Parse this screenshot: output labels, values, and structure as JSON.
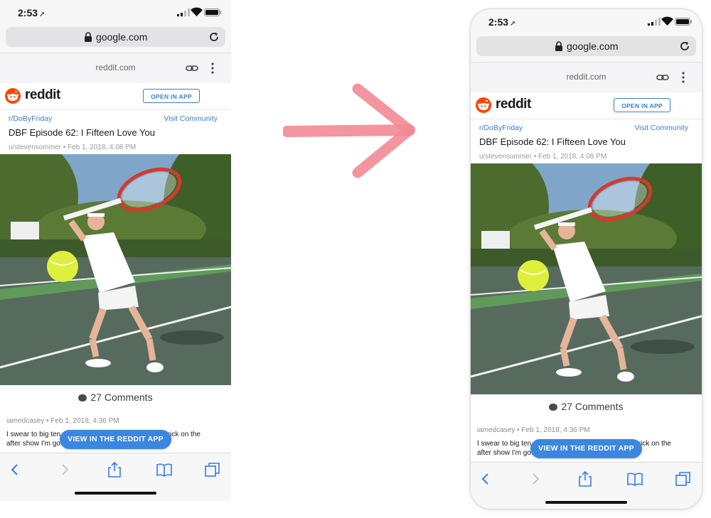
{
  "status_time": "2:53",
  "url_domain": "google.com",
  "page_site": "reddit.com",
  "reddit_wordmark": "reddit",
  "open_in_app": "OPEN IN APP",
  "subreddit": "r/DoByFriday",
  "visit_community": "Visit Community",
  "post_title": "DBF Episode 62: I Fifteen Love You",
  "post_meta": "u/stevensommer • Feb 1, 2018, 4:08 PM",
  "comments_count": "27 Comments",
  "comment_meta": "iamedcasey • Feb 1, 2018, 4:36 PM",
  "comment_text_a": "I swear to big ten",
  "comment_text_b": "d his trick on the",
  "comment_text_c": "after show I'm go",
  "view_in_app": "VIEW IN THE REDDIT APP",
  "colors": {
    "accent": "#3b86e0",
    "reddit_orange": "#ff4500",
    "arrow": "#f28a95"
  }
}
